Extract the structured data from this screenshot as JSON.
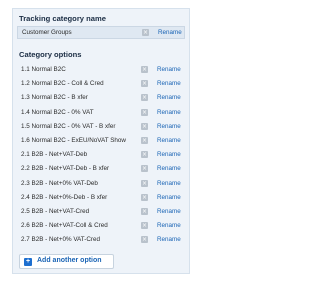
{
  "tracking_category": {
    "heading": "Tracking category name",
    "name": "Customer Groups",
    "delete_glyph": "×",
    "rename_label": "Rename"
  },
  "category_options": {
    "heading": "Category options",
    "delete_glyph": "×",
    "rename_label": "Rename",
    "items": [
      {
        "label": "1.1 Normal B2C"
      },
      {
        "label": "1.2 Normal B2C - Coll & Cred"
      },
      {
        "label": "1.3 Normal B2C - B xfer"
      },
      {
        "label": "1.4 Normal B2C - 0% VAT"
      },
      {
        "label": "1.5 Normal B2C - 0% VAT - B xfer"
      },
      {
        "label": "1.6 Normal B2C - ExEU/NoVAT Show"
      },
      {
        "label": "2.1 B2B - Net+VAT-Deb"
      },
      {
        "label": "2.2 B2B - Net+VAT-Deb - B xfer"
      },
      {
        "label": "2.3 B2B - Net+0% VAT-Deb"
      },
      {
        "label": "2.4 B2B - Net+0%-Deb - B xfer"
      },
      {
        "label": "2.5 B2B - Net+VAT-Cred"
      },
      {
        "label": "2.6 B2B - Net+VAT-Coll & Cred"
      },
      {
        "label": "2.7 B2B - Net+0% VAT-Cred"
      }
    ]
  },
  "add_button": {
    "label": "Add another option",
    "icon": "plus-icon"
  },
  "colors": {
    "link": "#1a64b5",
    "panel_bg": "#eef3f9",
    "accent": "#1d6fd0"
  }
}
